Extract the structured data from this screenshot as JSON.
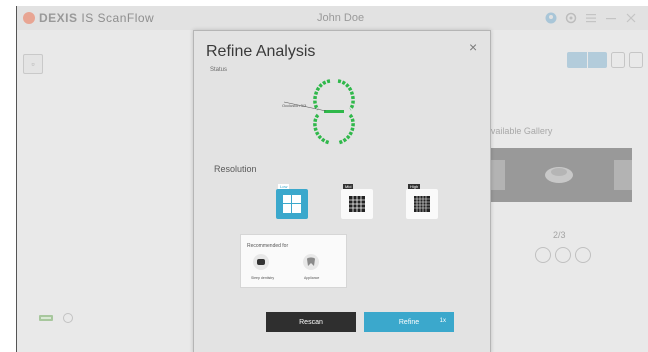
{
  "app": {
    "brand_name": "DEXIS",
    "brand_product": "IS ScanFlow",
    "patient_name": "John Doe"
  },
  "background": {
    "gallery_label": "Available Gallery",
    "gallery_counter": "2/3"
  },
  "modal": {
    "title": "Refine Analysis",
    "close_glyph": "×",
    "status_label": "Status",
    "arch_annotation": "Occlusion 3/3",
    "resolution_label": "Resolution",
    "resolution_options": [
      {
        "tag": "Low",
        "selected": true
      },
      {
        "tag": "Mid",
        "selected": false
      },
      {
        "tag": "High",
        "selected": false
      }
    ],
    "recommended": {
      "title": "Recommended for",
      "items": [
        {
          "caption": "Sleep dentistry",
          "icon": "sleep-device-icon"
        },
        {
          "caption": "Appliance",
          "icon": "tooth-appliance-icon"
        }
      ]
    },
    "buttons": {
      "rescan": "Rescan",
      "refine": "Refine",
      "refine_count": "1x"
    }
  },
  "colors": {
    "accent": "#3ba8cc",
    "arch_green": "#2fb84a",
    "dark_button": "#2f2f2f"
  }
}
